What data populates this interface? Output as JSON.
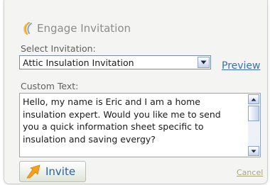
{
  "title": "Engage Invitation",
  "select_label": "Select Invitation:",
  "selected_invitation": "Attic Insulation Invitation",
  "preview_link": "Preview",
  "custom_text_label": "Custom Text:",
  "custom_text_lines": [
    "Hello, my name is Eric and I am a home",
    "insulation expert.  Would you like me to send",
    "you a quick information sheet specific to",
    "insulation and saving evergy?"
  ],
  "invite_button": "Invite",
  "cancel_link": "Cancel",
  "icons": {
    "title": "engage-swoosh-icon",
    "select": "dropdown-arrow-icon",
    "invite": "send-arrow-icon"
  },
  "colors": {
    "link_blue": "#3a6fb6",
    "cancel": "#a7a67a",
    "accent_orange": "#f5a21a"
  }
}
